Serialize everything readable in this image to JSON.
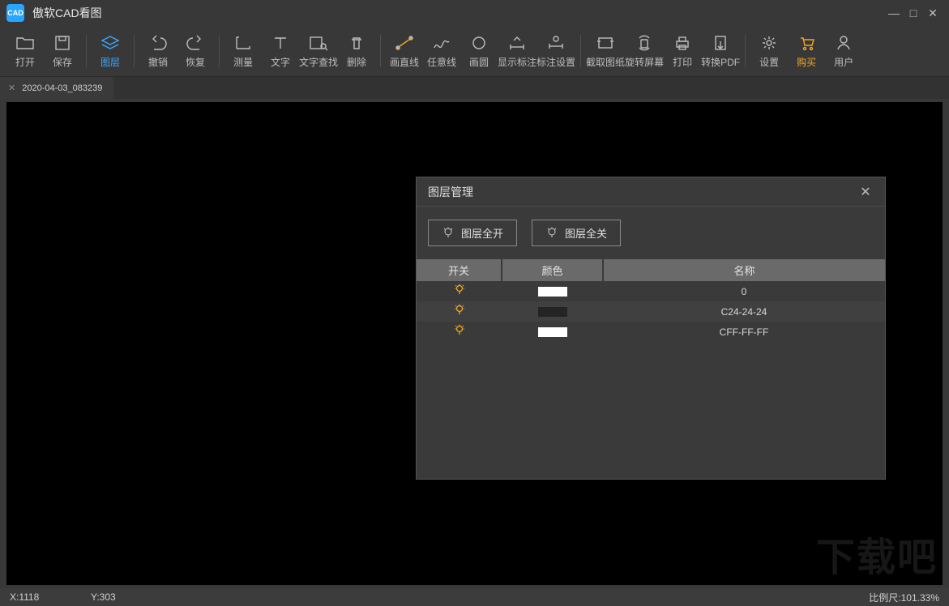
{
  "app": {
    "title": "傲软CAD看图",
    "logo_text": "CAD"
  },
  "window_controls": {
    "min": "—",
    "max": "□",
    "close": "✕"
  },
  "toolbar": {
    "items": [
      {
        "id": "open",
        "label": "打开"
      },
      {
        "id": "save",
        "label": "保存"
      },
      {
        "id": "layers",
        "label": "图层",
        "active": true
      },
      {
        "id": "undo",
        "label": "撤销"
      },
      {
        "id": "redo",
        "label": "恢复"
      },
      {
        "id": "measure",
        "label": "测量"
      },
      {
        "id": "text",
        "label": "文字"
      },
      {
        "id": "findtext",
        "label": "文字查找"
      },
      {
        "id": "delete",
        "label": "删除"
      },
      {
        "id": "line",
        "label": "画直线"
      },
      {
        "id": "freeline",
        "label": "任意线"
      },
      {
        "id": "circle",
        "label": "画圆"
      },
      {
        "id": "showanno",
        "label": "显示标注"
      },
      {
        "id": "annosettings",
        "label": "标注设置"
      },
      {
        "id": "capture",
        "label": "截取图纸"
      },
      {
        "id": "rotate",
        "label": "旋转屏幕"
      },
      {
        "id": "print",
        "label": "打印"
      },
      {
        "id": "topdf",
        "label": "转换PDF"
      },
      {
        "id": "settings",
        "label": "设置"
      },
      {
        "id": "buy",
        "label": "购买",
        "accent": true
      },
      {
        "id": "user",
        "label": "用户"
      }
    ],
    "separators_after": [
      "save",
      "layers",
      "redo",
      "delete",
      "annosettings",
      "topdf"
    ]
  },
  "tabs": [
    {
      "label": "2020-04-03_083239"
    }
  ],
  "status": {
    "x_label": "X:1118",
    "y_label": "Y:303",
    "scale_label": "比例尺:101.33%"
  },
  "dialog": {
    "title": "图层管理",
    "btn_all_on": "图层全开",
    "btn_all_off": "图层全关",
    "headers": {
      "switch": "开关",
      "color": "颜色",
      "name": "名称"
    },
    "rows": [
      {
        "on": true,
        "color": "#ffffff",
        "name": "0"
      },
      {
        "on": true,
        "color": "#242424",
        "name": "C24-24-24"
      },
      {
        "on": true,
        "color": "#ffffff",
        "name": "CFF-FF-FF"
      }
    ]
  },
  "watermark": "下载吧"
}
